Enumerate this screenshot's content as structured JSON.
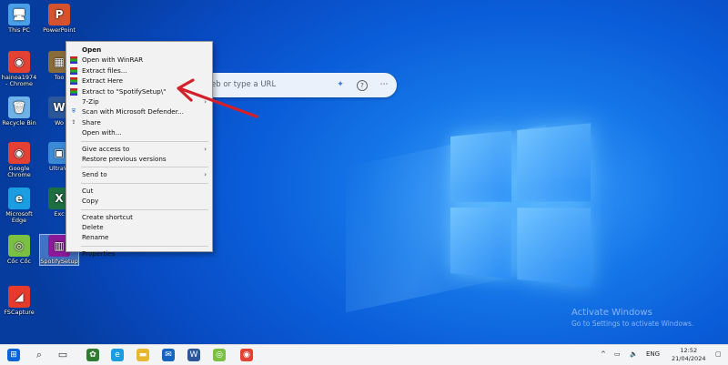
{
  "desktop": {
    "icons": [
      {
        "label": "This PC",
        "glyph": "🖥",
        "color": "#4aa0e8"
      },
      {
        "label": "PowerPoint",
        "glyph": "P",
        "color": "#d35230"
      },
      {
        "label": "hainoa1974 - Chrome",
        "glyph": "◉",
        "color": "#e34133"
      },
      {
        "label": "Too",
        "glyph": "▦",
        "color": "#8a6b3a"
      },
      {
        "label": "Recycle Bin",
        "glyph": "🗑",
        "color": "#6fb2e8"
      },
      {
        "label": "Wo",
        "glyph": "W",
        "color": "#2b579a"
      },
      {
        "label": "Google Chrome",
        "glyph": "◉",
        "color": "#e34133"
      },
      {
        "label": "UltraVi",
        "glyph": "▣",
        "color": "#3a8ad6"
      },
      {
        "label": "Microsoft Edge",
        "glyph": "e",
        "color": "#1b9de2"
      },
      {
        "label": "Exc",
        "glyph": "X",
        "color": "#1d6f42"
      },
      {
        "label": "Cốc Cốc",
        "glyph": "◎",
        "color": "#7bc043"
      },
      {
        "label": "SpotifySetup",
        "glyph": "▥",
        "color": "#8b1a9a"
      },
      {
        "label": "FSCapture",
        "glyph": "◢",
        "color": "#e43b2c"
      }
    ]
  },
  "browser_search": {
    "placeholder": "eb or type a URL",
    "icons": [
      "copilot-icon",
      "help-icon",
      "more-icon"
    ]
  },
  "context_menu": {
    "items": [
      {
        "label": "Open",
        "bold": true,
        "icon": ""
      },
      {
        "label": "Open with WinRAR",
        "icon": "rar"
      },
      {
        "label": "Extract files...",
        "icon": "rar"
      },
      {
        "label": "Extract Here",
        "icon": "rar"
      },
      {
        "label": "Extract to \"SpotifySetup\\\"",
        "icon": "rar"
      },
      {
        "label": "7-Zip",
        "icon": "",
        "arrow": true
      },
      {
        "label": "Scan with Microsoft Defender...",
        "icon": "shield"
      },
      {
        "label": "Share",
        "icon": "share"
      },
      {
        "label": "Open with...",
        "icon": ""
      },
      {
        "sep": true
      },
      {
        "label": "Give access to",
        "icon": "",
        "arrow": true
      },
      {
        "label": "Restore previous versions",
        "icon": ""
      },
      {
        "sep": true
      },
      {
        "label": "Send to",
        "icon": "",
        "arrow": true
      },
      {
        "sep": true
      },
      {
        "label": "Cut",
        "icon": ""
      },
      {
        "label": "Copy",
        "icon": ""
      },
      {
        "sep": true
      },
      {
        "label": "Create shortcut",
        "icon": ""
      },
      {
        "label": "Delete",
        "icon": ""
      },
      {
        "label": "Rename",
        "icon": ""
      },
      {
        "sep": true
      },
      {
        "label": "Properties",
        "icon": ""
      }
    ]
  },
  "watermark": {
    "line1": "Activate Windows",
    "line2": "Go to Settings to activate Windows."
  },
  "taskbar": {
    "apps": [
      {
        "name": "start-button",
        "glyph": "⊞",
        "color": "#0a64d8"
      },
      {
        "name": "search-button",
        "glyph": "⌕",
        "color": "#333"
      },
      {
        "name": "task-view-button",
        "glyph": "▭",
        "color": "#333"
      },
      {
        "name": "xbox-app",
        "glyph": "✿",
        "color": "#2e7d32"
      },
      {
        "name": "edge-app",
        "glyph": "e",
        "color": "#1b9de2"
      },
      {
        "name": "file-explorer-app",
        "glyph": "▬",
        "color": "#e8b730"
      },
      {
        "name": "mail-app",
        "glyph": "✉",
        "color": "#1565c0"
      },
      {
        "name": "word-app",
        "glyph": "W",
        "color": "#2b579a"
      },
      {
        "name": "coccoc-app",
        "glyph": "◎",
        "color": "#7bc043"
      },
      {
        "name": "chrome-app",
        "glyph": "◉",
        "color": "#e34133"
      }
    ],
    "tray": {
      "chevron": "^",
      "language": "ENG",
      "time": "12:52",
      "date": "21/04/2024"
    }
  }
}
